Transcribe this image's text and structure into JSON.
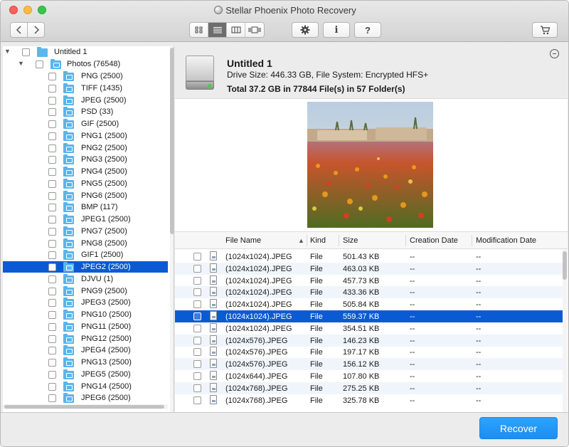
{
  "window": {
    "title": "Stellar Phoenix Photo Recovery"
  },
  "toolbar": {
    "back_icon": "chevron-left-icon",
    "forward_icon": "chevron-right-icon",
    "views": [
      "icon-view",
      "list-view",
      "column-view",
      "cover-flow-view"
    ],
    "active_view": "list-view",
    "settings_icon": "gear-icon",
    "info_label": "i",
    "help_label": "?",
    "cart_icon": "cart-icon"
  },
  "tree": {
    "root": {
      "label": "Untitled 1"
    },
    "photos": {
      "label": "Photos (76548)"
    },
    "items": [
      "PNG (2500)",
      "TIFF (1435)",
      "JPEG (2500)",
      "PSD (33)",
      "GIF (2500)",
      "PNG1 (2500)",
      "PNG2 (2500)",
      "PNG3 (2500)",
      "PNG4 (2500)",
      "PNG5 (2500)",
      "PNG6 (2500)",
      "BMP (117)",
      "JPEG1 (2500)",
      "PNG7 (2500)",
      "PNG8 (2500)",
      "GIF1 (2500)",
      "JPEG2 (2500)",
      "DJVU (1)",
      "PNG9 (2500)",
      "JPEG3 (2500)",
      "PNG10 (2500)",
      "PNG11 (2500)",
      "PNG12 (2500)",
      "JPEG4 (2500)",
      "PNG13 (2500)",
      "JPEG5 (2500)",
      "PNG14 (2500)",
      "JPEG6 (2500)"
    ],
    "selected_index": 16
  },
  "drive": {
    "name": "Untitled 1",
    "details": "Drive Size: 446.33 GB, File System: Encrypted HFS+",
    "total": "Total 37.2 GB in 77844 File(s) in 57 Folder(s)"
  },
  "file_list": {
    "columns": [
      "File Name",
      "Kind",
      "Size",
      "Creation Date",
      "Modification Date"
    ],
    "rows": [
      {
        "name": "(1024x1024).JPEG",
        "kind": "File",
        "size": "501.43 KB",
        "created": "--",
        "modified": "--"
      },
      {
        "name": "(1024x1024).JPEG",
        "kind": "File",
        "size": "463.03 KB",
        "created": "--",
        "modified": "--"
      },
      {
        "name": "(1024x1024).JPEG",
        "kind": "File",
        "size": "457.73 KB",
        "created": "--",
        "modified": "--"
      },
      {
        "name": "(1024x1024).JPEG",
        "kind": "File",
        "size": "433.36 KB",
        "created": "--",
        "modified": "--"
      },
      {
        "name": "(1024x1024).JPEG",
        "kind": "File",
        "size": "505.84 KB",
        "created": "--",
        "modified": "--"
      },
      {
        "name": "(1024x1024).JPEG",
        "kind": "File",
        "size": "559.37 KB",
        "created": "--",
        "modified": "--"
      },
      {
        "name": "(1024x1024).JPEG",
        "kind": "File",
        "size": "354.51 KB",
        "created": "--",
        "modified": "--"
      },
      {
        "name": "(1024x576).JPEG",
        "kind": "File",
        "size": "146.23 KB",
        "created": "--",
        "modified": "--"
      },
      {
        "name": "(1024x576).JPEG",
        "kind": "File",
        "size": "197.17 KB",
        "created": "--",
        "modified": "--"
      },
      {
        "name": "(1024x576).JPEG",
        "kind": "File",
        "size": "156.12 KB",
        "created": "--",
        "modified": "--"
      },
      {
        "name": "(1024x644).JPEG",
        "kind": "File",
        "size": "107.80 KB",
        "created": "--",
        "modified": "--"
      },
      {
        "name": "(1024x768).JPEG",
        "kind": "File",
        "size": "275.25 KB",
        "created": "--",
        "modified": "--"
      },
      {
        "name": "(1024x768).JPEG",
        "kind": "File",
        "size": "325.78 KB",
        "created": "--",
        "modified": "--"
      }
    ],
    "selected_index": 5
  },
  "footer": {
    "recover_label": "Recover"
  },
  "colors": {
    "selection": "#0a5bd3",
    "accent": "#1a8ef5",
    "folder": "#5bb4ea"
  }
}
